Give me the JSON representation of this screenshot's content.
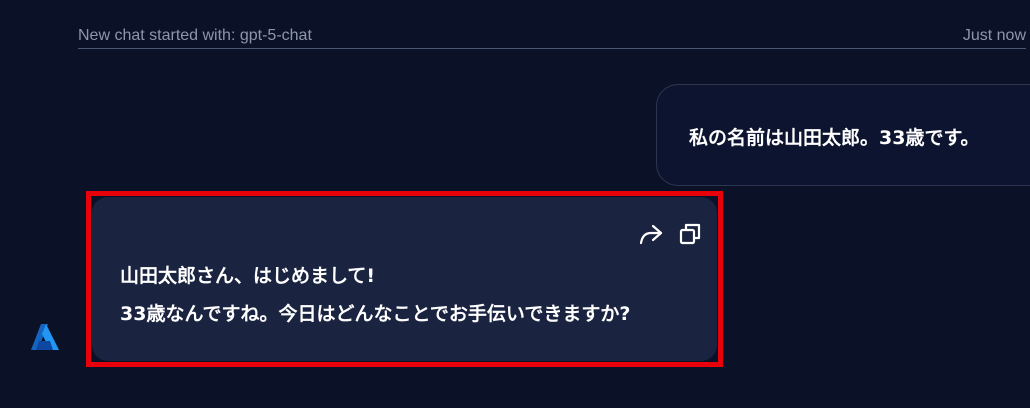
{
  "header": {
    "started_text": "New chat started with: gpt-5-chat",
    "timestamp": "Just now"
  },
  "messages": {
    "user": {
      "text": "私の名前は山田太郎。33歳です。"
    },
    "assistant": {
      "line1": "山田太郎さん、はじめまして!",
      "line2": "33歳なんですね。今日はどんなことでお手伝いできますか?"
    }
  },
  "icons": {
    "share": "share-icon",
    "copy": "copy-icon",
    "avatar": "azure-icon"
  },
  "colors": {
    "background": "#0b1228",
    "assistant_bubble": "#1a2340",
    "highlight": "#e8000b",
    "azure_blue": "#1e88e5"
  }
}
